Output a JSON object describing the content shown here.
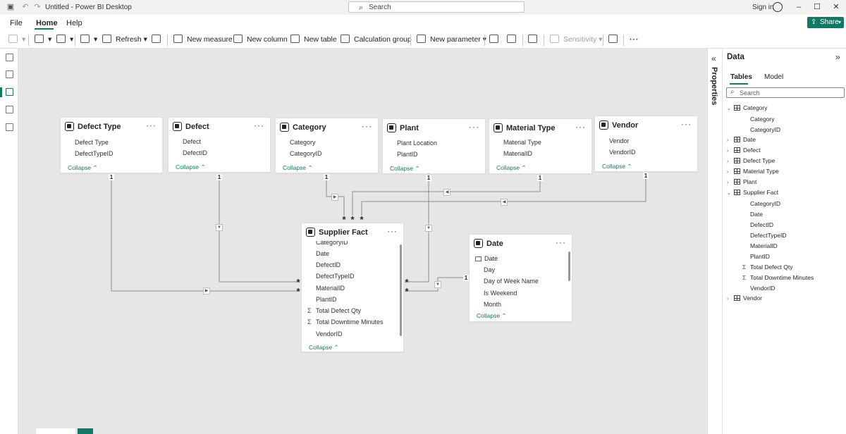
{
  "window": {
    "title": "Untitled - Power BI Desktop",
    "search_placeholder": "Search",
    "sign_in": "Sign in"
  },
  "menu": {
    "file": "File",
    "home": "Home",
    "help": "Help",
    "share": "Share"
  },
  "ribbon": {
    "refresh": "Refresh",
    "new_measure": "New measure",
    "new_column": "New column",
    "new_table": "New table",
    "calculation_group": "Calculation group",
    "new_parameter": "New parameter",
    "sensitivity": "Sensitivity"
  },
  "canvas": {
    "tables": [
      {
        "title": "Defect Type",
        "fields": [
          "Defect Type",
          "DefectTypeID"
        ],
        "collapse": "Collapse"
      },
      {
        "title": "Defect",
        "fields": [
          "Defect",
          "DefectID"
        ],
        "collapse": "Collapse"
      },
      {
        "title": "Category",
        "fields": [
          "Category",
          "CategoryID"
        ],
        "collapse": "Collapse"
      },
      {
        "title": "Plant",
        "fields": [
          "Plant Location",
          "PlantID"
        ],
        "collapse": "Collapse"
      },
      {
        "title": "Material Type",
        "fields": [
          "Material Type",
          "MaterialID"
        ],
        "collapse": "Collapse"
      },
      {
        "title": "Vendor",
        "fields": [
          "Vendor",
          "VendorID"
        ],
        "collapse": "Collapse"
      }
    ],
    "supplier_fact": {
      "title": "Supplier Fact",
      "fields": [
        "CategoryID",
        "Date",
        "DefectID",
        "DefectTypeID",
        "MaterialID",
        "PlantID",
        "Total Defect Qty",
        "Total Downtime Minutes",
        "VendorID"
      ],
      "collapse": "Collapse"
    },
    "date_table": {
      "title": "Date",
      "fields": [
        "Date",
        "Day",
        "Day of Week Name",
        "Is Weekend",
        "Month"
      ],
      "collapse": "Collapse"
    },
    "cardinality_one": "1",
    "cardinality_many": "*",
    "sum_symbol": "Σ",
    "more_symbol": "···"
  },
  "properties": {
    "label": "Properties"
  },
  "data_pane": {
    "title": "Data",
    "tabs": [
      "Tables",
      "Model"
    ],
    "search_placeholder": "Search",
    "tree": [
      {
        "name": "Category",
        "expanded": true,
        "children": [
          "Category",
          "CategoryID"
        ]
      },
      {
        "name": "Date",
        "expanded": false
      },
      {
        "name": "Defect",
        "expanded": false
      },
      {
        "name": "Defect Type",
        "expanded": false
      },
      {
        "name": "Material Type",
        "expanded": false
      },
      {
        "name": "Plant",
        "expanded": false
      },
      {
        "name": "Supplier Fact",
        "expanded": true,
        "children": [
          "CategoryID",
          "Date",
          "DefectID",
          "DefectTypeID",
          "MaterialID",
          "PlantID",
          "Total Defect Qty",
          "Total Downtime Minutes",
          "VendorID"
        ]
      },
      {
        "name": "Vendor",
        "expanded": false
      }
    ]
  },
  "colors": {
    "accent": "#117865",
    "canvas": "#e6e6e6"
  }
}
